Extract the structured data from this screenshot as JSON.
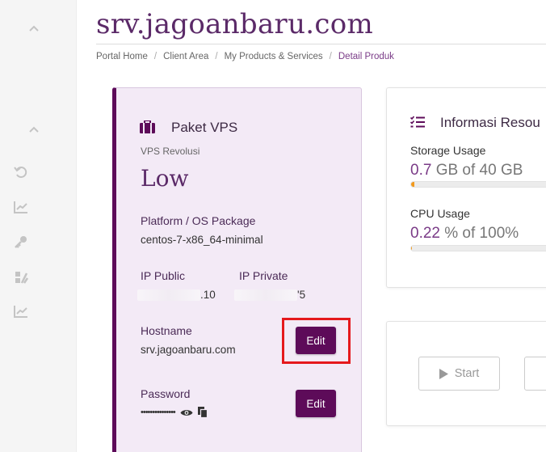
{
  "page": {
    "title": "srv.jagoanbaru.com"
  },
  "breadcrumb": [
    "Portal Home",
    "Client Area",
    "My Products & Services",
    "Detail Produk"
  ],
  "sidebar": {
    "icons": [
      "chevron-up-icon",
      "chevron-up-icon",
      "undo-icon",
      "chart-icon",
      "key-icon",
      "tools-icon",
      "chart-icon"
    ]
  },
  "vps_card": {
    "title": "Paket VPS",
    "subtitle": "VPS Revolusi",
    "plan": "Low",
    "platform_label": "Platform / OS Package",
    "platform_value": "centos-7-x86_64-minimal",
    "ip_public_label": "IP Public",
    "ip_public_suffix": ".10",
    "ip_private_label": "IP Private",
    "ip_private_suffix": "'5",
    "hostname_label": "Hostname",
    "hostname_value": "srv.jagoanbaru.com",
    "hostname_edit": "Edit",
    "password_label": "Password",
    "password_mask": "•••••••••••••••",
    "password_edit": "Edit"
  },
  "resource_card": {
    "title": "Informasi Resou",
    "storage_label": "Storage Usage",
    "storage_used": "0.7",
    "storage_rest": " GB of 40 GB",
    "storage_fraction": 0.0175,
    "cpu_label": "CPU Usage",
    "cpu_used": "0.22",
    "cpu_rest": " % of 100%",
    "cpu_fraction": 0.0022
  },
  "control_card": {
    "start_label": "Start"
  },
  "colors": {
    "brand": "#5d0b59",
    "accent": "#7a3b87",
    "highlight": "#e5191c",
    "bar_fill": "#f29a1e"
  }
}
